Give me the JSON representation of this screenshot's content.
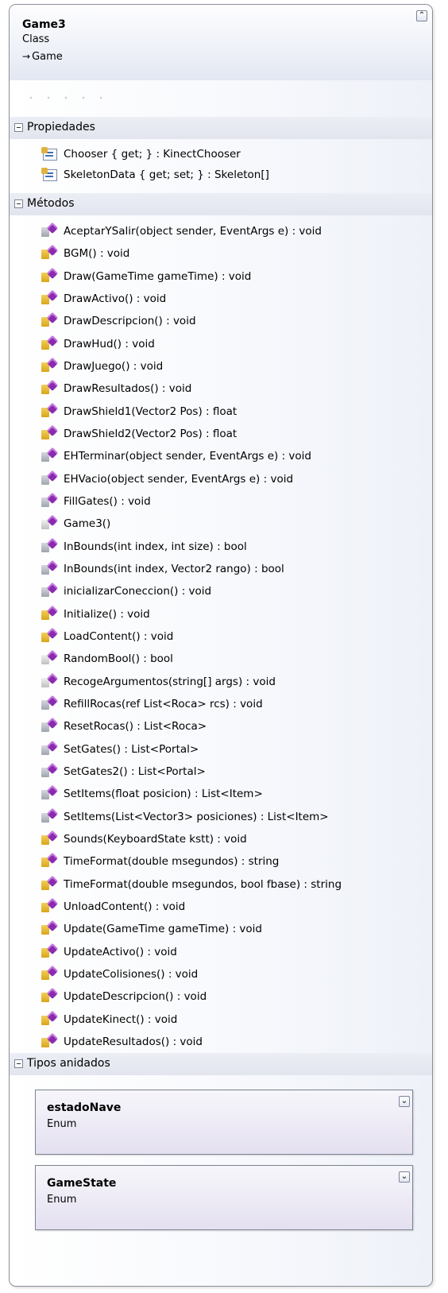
{
  "class": {
    "name": "Game3",
    "kind": "Class",
    "base_arrow": "→",
    "base": "Game",
    "collapse_glyph": "⌃"
  },
  "sections": {
    "properties": {
      "label": "Propiedades",
      "items": [
        {
          "text": "Chooser { get; } : KinectChooser",
          "icon": "property-icon"
        },
        {
          "text": "SkeletonData { get; set; } : Skeleton[]",
          "icon": "property-icon"
        }
      ]
    },
    "methods": {
      "label": "Métodos",
      "items": [
        {
          "text": "AceptarYSalir(object sender, EventArgs e) : void",
          "icon": "private-method-icon"
        },
        {
          "text": "BGM() : void",
          "icon": "method-icon"
        },
        {
          "text": "Draw(GameTime gameTime) : void",
          "icon": "method-icon"
        },
        {
          "text": "DrawActivo() : void",
          "icon": "method-icon"
        },
        {
          "text": "DrawDescripcion() : void",
          "icon": "method-icon"
        },
        {
          "text": "DrawHud() : void",
          "icon": "method-icon"
        },
        {
          "text": "DrawJuego() : void",
          "icon": "method-icon"
        },
        {
          "text": "DrawResultados() : void",
          "icon": "method-icon"
        },
        {
          "text": "DrawShield1(Vector2 Pos) : float",
          "icon": "method-icon"
        },
        {
          "text": "DrawShield2(Vector2 Pos) : float",
          "icon": "method-icon"
        },
        {
          "text": "EHTerminar(object sender, EventArgs e) : void",
          "icon": "private-method-icon"
        },
        {
          "text": "EHVacio(object sender, EventArgs e) : void",
          "icon": "private-method-icon"
        },
        {
          "text": "FillGates() : void",
          "icon": "private-method-icon"
        },
        {
          "text": "Game3()",
          "icon": "public-method-icon"
        },
        {
          "text": "InBounds(int index, int size) : bool",
          "icon": "private-method-icon"
        },
        {
          "text": "InBounds(int index, Vector2 rango) : bool",
          "icon": "private-method-icon"
        },
        {
          "text": "inicializarConeccion() : void",
          "icon": "private-method-icon"
        },
        {
          "text": "Initialize() : void",
          "icon": "method-icon"
        },
        {
          "text": "LoadContent() : void",
          "icon": "method-icon"
        },
        {
          "text": "RandomBool() : bool",
          "icon": "public-method-icon"
        },
        {
          "text": "RecogeArgumentos(string[] args) : void",
          "icon": "public-method-icon"
        },
        {
          "text": "RefillRocas(ref List<Roca> rcs) : void",
          "icon": "private-method-icon"
        },
        {
          "text": "ResetRocas() : List<Roca>",
          "icon": "private-method-icon"
        },
        {
          "text": "SetGates() : List<Portal>",
          "icon": "private-method-icon"
        },
        {
          "text": "SetGates2() : List<Portal>",
          "icon": "private-method-icon"
        },
        {
          "text": "SetItems(float posicion) : List<Item>",
          "icon": "private-method-icon"
        },
        {
          "text": "SetItems(List<Vector3> posiciones) : List<Item>",
          "icon": "private-method-icon"
        },
        {
          "text": "Sounds(KeyboardState kstt) : void",
          "icon": "method-icon"
        },
        {
          "text": "TimeFormat(double msegundos) : string",
          "icon": "method-icon"
        },
        {
          "text": "TimeFormat(double msegundos, bool fbase) : string",
          "icon": "method-icon"
        },
        {
          "text": "UnloadContent() : void",
          "icon": "method-icon"
        },
        {
          "text": "Update(GameTime gameTime) : void",
          "icon": "method-icon"
        },
        {
          "text": "UpdateActivo() : void",
          "icon": "method-icon"
        },
        {
          "text": "UpdateColisiones() : void",
          "icon": "method-icon"
        },
        {
          "text": "UpdateDescripcion() : void",
          "icon": "method-icon"
        },
        {
          "text": "UpdateKinect() : void",
          "icon": "method-icon"
        },
        {
          "text": "UpdateResultados() : void",
          "icon": "method-icon"
        }
      ]
    },
    "nested_types": {
      "label": "Tipos anidados",
      "items": [
        {
          "name": "estadoNave",
          "kind": "Enum",
          "expand_glyph": "⌄"
        },
        {
          "name": "GameState",
          "kind": "Enum",
          "expand_glyph": "⌄"
        }
      ]
    }
  }
}
